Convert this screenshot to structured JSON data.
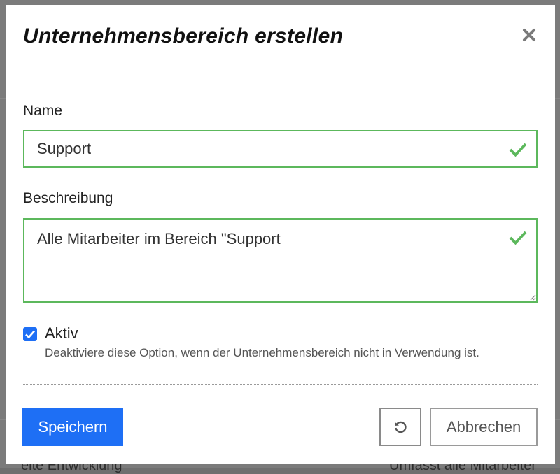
{
  "modal": {
    "title": "Unternehmensbereich erstellen"
  },
  "form": {
    "name_label": "Name",
    "name_value": "Support",
    "description_label": "Beschreibung",
    "description_value": "Alle Mitarbeiter im Bereich \"Support",
    "active_label": "Aktiv",
    "active_checked": true,
    "active_help": "Deaktiviere diese Option, wenn der Unternehmensbereich nicht in Verwendung ist."
  },
  "buttons": {
    "save": "Speichern",
    "cancel": "Abbrechen"
  },
  "background": {
    "footer_left": "eite Entwicklung",
    "footer_right": "Umfasst alle Mitarbeiter"
  },
  "colors": {
    "primary": "#1e6ff5",
    "valid": "#5cb85c"
  },
  "icons": {
    "close": "close-icon",
    "valid": "checkmark-icon",
    "reset": "reset-icon"
  }
}
